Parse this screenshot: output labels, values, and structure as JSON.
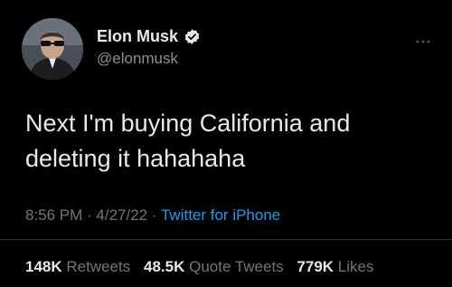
{
  "user": {
    "display_name": "Elon Musk",
    "handle": "@elonmusk",
    "verified": true
  },
  "tweet": {
    "text": "Next I'm buying California and\ndeleting it hahahaha",
    "time": "8:56 PM",
    "date": "4/27/22",
    "separator": " · ",
    "source": "Twitter for iPhone"
  },
  "stats": {
    "retweets_count": "148K",
    "retweets_label": "Retweets",
    "quotes_count": "48.5K",
    "quotes_label": "Quote Tweets",
    "likes_count": "779K",
    "likes_label": "Likes"
  },
  "icons": {
    "verified": "verified-badge-icon",
    "more": "more-options-icon"
  },
  "colors": {
    "background": "#000000",
    "text": "#e7e9ea",
    "muted": "#71767b",
    "link": "#1d9bf0"
  }
}
